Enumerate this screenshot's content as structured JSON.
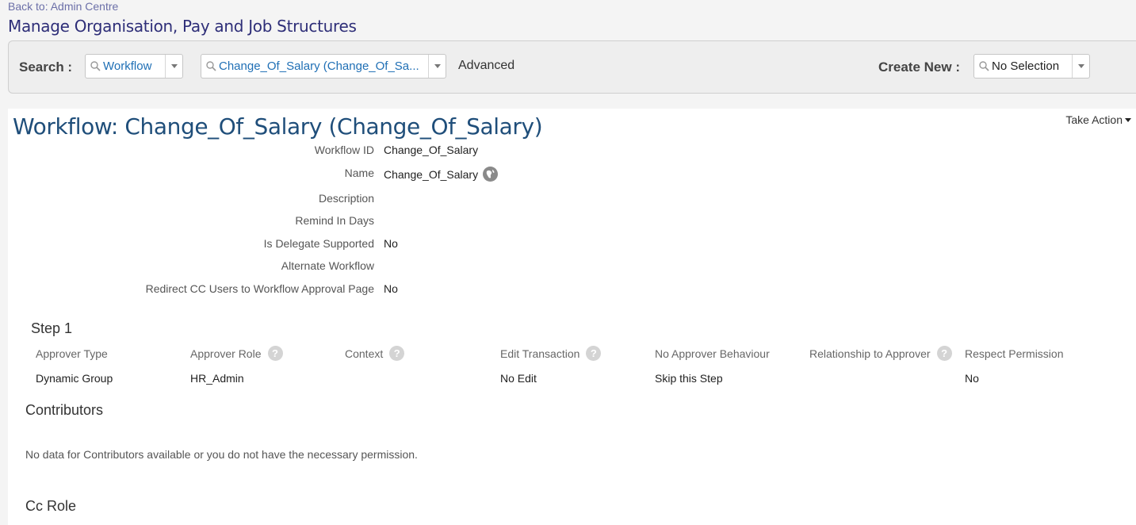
{
  "header": {
    "back_link": "Back to: Admin Centre",
    "page_title": "Manage Organisation, Pay and Job Structures"
  },
  "search": {
    "label": "Search :",
    "type_value": "Workflow",
    "item_value": "Change_Of_Salary (Change_Of_Sa...",
    "advanced_label": "Advanced",
    "create_new_label": "Create New :",
    "create_new_value": "No Selection"
  },
  "workflow": {
    "title": "Workflow: Change_Of_Salary (Change_Of_Salary)",
    "take_action_label": "Take Action",
    "fields": [
      {
        "label": "Workflow ID",
        "value": "Change_Of_Salary"
      },
      {
        "label": "Name",
        "value": "Change_Of_Salary"
      },
      {
        "label": "Description",
        "value": ""
      },
      {
        "label": "Remind In Days",
        "value": ""
      },
      {
        "label": "Is Delegate Supported",
        "value": "No"
      },
      {
        "label": "Alternate Workflow",
        "value": ""
      },
      {
        "label": "Redirect CC Users to Workflow Approval Page",
        "value": "No"
      }
    ]
  },
  "step": {
    "title": "Step 1",
    "columns": [
      "Approver Type",
      "Approver Role",
      "Context",
      "Edit Transaction",
      "No Approver Behaviour",
      "Relationship to Approver",
      "Respect Permission"
    ],
    "row": [
      "Dynamic Group",
      "HR_Admin",
      "",
      "No Edit",
      "Skip this Step",
      "",
      "No"
    ]
  },
  "contributors": {
    "title": "Contributors",
    "empty_text": "No data for Contributors available or you do not have the necessary permission."
  },
  "cc_role": {
    "title": "Cc Role"
  },
  "icons": {
    "search": "magnifier-icon",
    "dropdown": "chevron-down-icon",
    "help": "question-mark-icon",
    "translate": "globe-icon"
  },
  "colors": {
    "title_blue": "#1f4e7a",
    "page_title_purple": "#2e2e78",
    "link_blue": "#1f6fb5"
  }
}
